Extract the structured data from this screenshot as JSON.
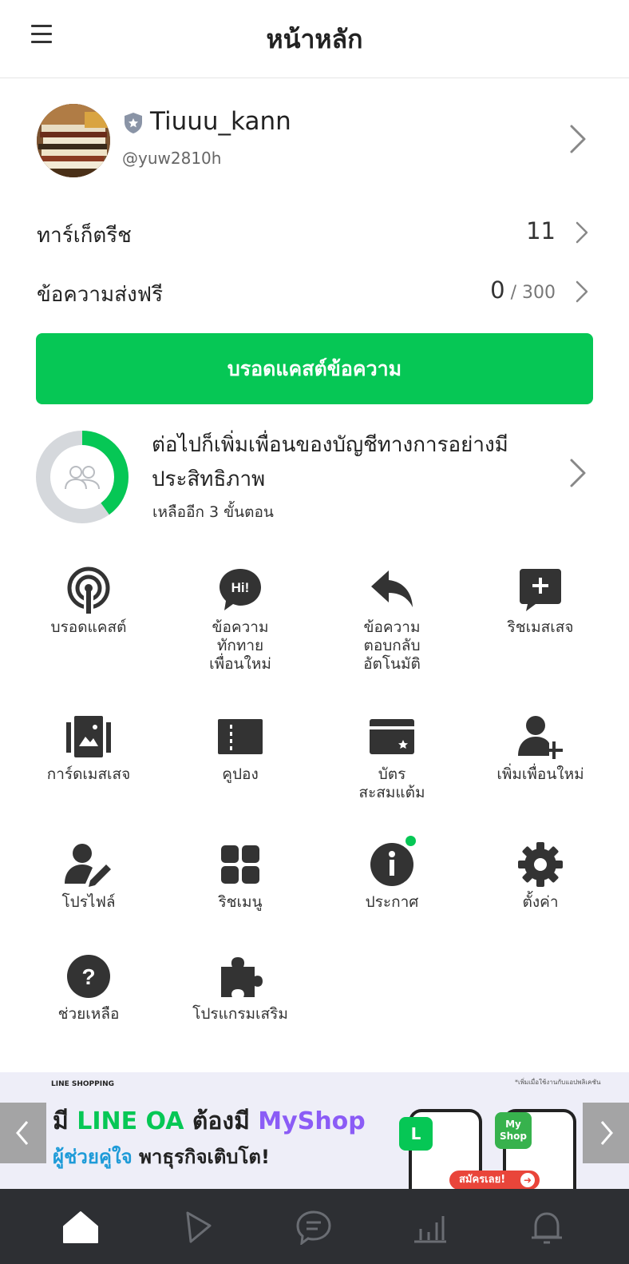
{
  "header": {
    "title": "หน้าหลัก"
  },
  "profile": {
    "name": "Tiuuu_kann",
    "handle": "@yuw2810h"
  },
  "stats": [
    {
      "label": "ทาร์เก็ตรีช",
      "value": "11",
      "sub": ""
    },
    {
      "label": "ข้อความส่งฟรี",
      "value": "0",
      "sub": " / 300"
    }
  ],
  "broadcast_button": "บรอดแคสต์ข้อความ",
  "progress": {
    "title": "ต่อไปก็เพิ่มเพื่อนของบัญชีทางการอย่างมีประสิทธิภาพ",
    "subtitle": "เหลืออีก 3 ขั้นตอน",
    "fraction": 0.4
  },
  "menu": [
    {
      "label": "บรอดแคสต์",
      "icon": "broadcast-icon"
    },
    {
      "label": "ข้อความ\nทักทาย\nเพื่อนใหม่",
      "icon": "greeting-icon"
    },
    {
      "label": "ข้อความ\nตอบกลับ\nอัตโนมัติ",
      "icon": "reply-icon"
    },
    {
      "label": "ริชเมสเสจ",
      "icon": "rich-message-icon"
    },
    {
      "label": "การ์ดเมสเสจ",
      "icon": "card-message-icon"
    },
    {
      "label": "คูปอง",
      "icon": "coupon-icon"
    },
    {
      "label": "บัตร\nสะสมแต้ม",
      "icon": "reward-card-icon"
    },
    {
      "label": "เพิ่มเพื่อนใหม่",
      "icon": "add-friend-icon"
    },
    {
      "label": "โปรไฟล์",
      "icon": "profile-edit-icon"
    },
    {
      "label": "ริชเมนู",
      "icon": "rich-menu-icon"
    },
    {
      "label": "ประกาศ",
      "icon": "info-icon"
    },
    {
      "label": "ตั้งค่า",
      "icon": "gear-icon"
    },
    {
      "label": "ช่วยเหลือ",
      "icon": "help-icon"
    },
    {
      "label": "โปรแกรมเสริม",
      "icon": "puzzle-icon"
    }
  ],
  "banner": {
    "brand": "LINE SHOPPING",
    "line1_a": "มี ",
    "line1_b": "LINE OA",
    "line1_c": " ต้องมี ",
    "line1_d": "MyShop",
    "line2_a": "ผู้ช่วยคู่ใจ",
    "line2_b": " พาธุรกิจเติบโต!",
    "note": "*เพิ่มเมื่อใช้งานกับแอปพลิเคชัน",
    "badge_l": "L",
    "badge_myshop": "My\nShop",
    "cta": "สมัครเลย!"
  },
  "tabs": [
    "home-icon",
    "voom-icon",
    "chat-icon",
    "insight-icon",
    "bell-icon"
  ],
  "colors": {
    "accent": "#06c755",
    "dark": "#2d2f33",
    "icon": "#333333",
    "banner_bg": "#eeeef8"
  }
}
